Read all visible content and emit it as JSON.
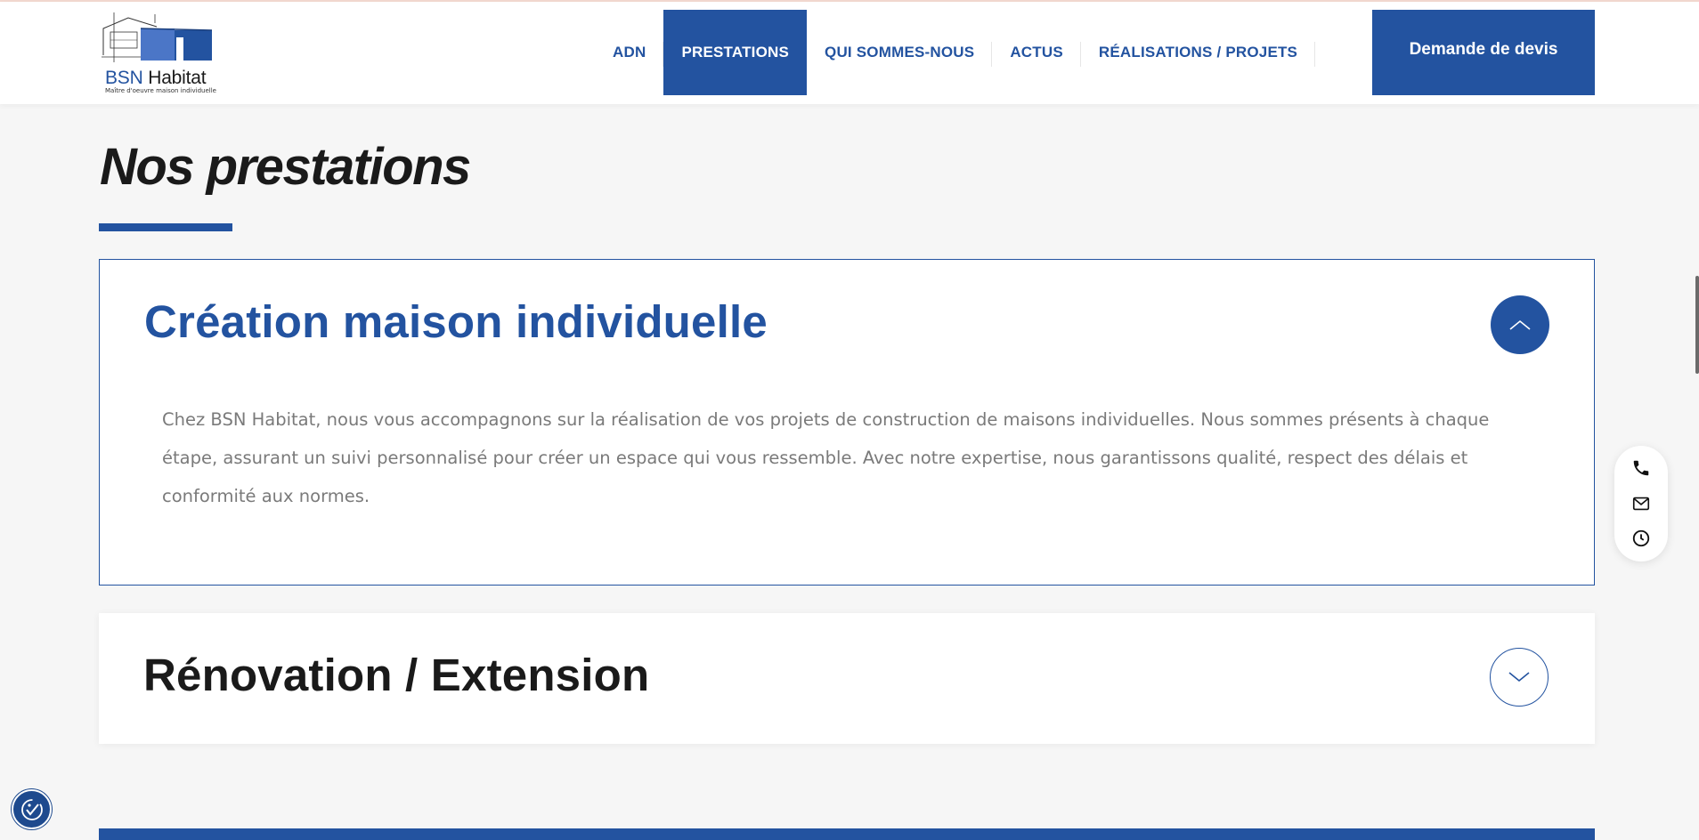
{
  "brand": {
    "name_part1": "BSN",
    "name_part2": "Habitat",
    "tagline": "Maître d'oeuvre maison individuelle",
    "primary_color": "#2353a0"
  },
  "nav": {
    "items": [
      {
        "label": "ADN",
        "active": false
      },
      {
        "label": "PRESTATIONS",
        "active": true
      },
      {
        "label": "QUI SOMMES-NOUS",
        "active": false
      },
      {
        "label": "ACTUS",
        "active": false
      },
      {
        "label": "RÉALISATIONS / PROJETS",
        "active": false
      }
    ],
    "cta_label": "Demande de devis"
  },
  "page": {
    "title": "Nos prestations"
  },
  "accordion": [
    {
      "title": "Création maison individuelle",
      "expanded": true,
      "text": "Chez BSN Habitat, nous vous accompagnons sur la réalisation de vos projets de construction de maisons individuelles. Nous sommes présents à chaque étape, assurant un suivi personnalisé pour créer un espace qui vous ressemble. Avec notre expertise, nous garantissons qualité, respect des délais et conformité aux normes."
    },
    {
      "title": "Rénovation / Extension",
      "expanded": false
    }
  ],
  "icons": {
    "contact": [
      "phone-icon",
      "mail-icon",
      "clock-icon"
    ],
    "accessibility": "accessibility-icon",
    "toggle_open": "chevron-up-icon",
    "toggle_closed": "chevron-down-icon"
  }
}
